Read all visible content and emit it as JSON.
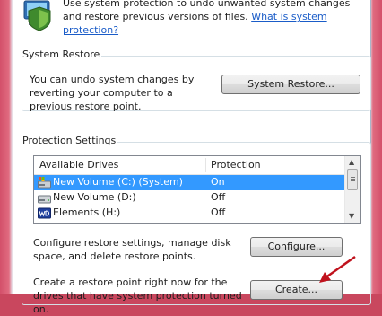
{
  "intro": {
    "text": "Use system protection to undo unwanted system changes and restore previous versions of files.",
    "link": "What is system protection?"
  },
  "system_restore": {
    "legend": "System Restore",
    "description": "You can undo system changes by reverting your computer to a previous restore point.",
    "button": "System Restore..."
  },
  "protection_settings": {
    "legend": "Protection Settings",
    "columns": {
      "drives": "Available Drives",
      "protection": "Protection"
    },
    "drives": [
      {
        "name": "New Volume (C:) (System)",
        "status": "On",
        "icon": "system-drive-icon",
        "selected": true
      },
      {
        "name": "New Volume (D:)",
        "status": "Off",
        "icon": "hard-drive-icon",
        "selected": false
      },
      {
        "name": "Elements (H:)",
        "status": "Off",
        "icon": "wd-external-drive-icon",
        "selected": false
      }
    ],
    "configure_text": "Configure restore settings, manage disk space, and delete restore points.",
    "configure_button": "Configure...",
    "create_text": "Create a restore point right now for the drives that have system protection turned on.",
    "create_button": "Create..."
  },
  "colors": {
    "selection": "#3399ff",
    "link": "#1a5cc8",
    "annotation_arrow": "#c0121d"
  }
}
